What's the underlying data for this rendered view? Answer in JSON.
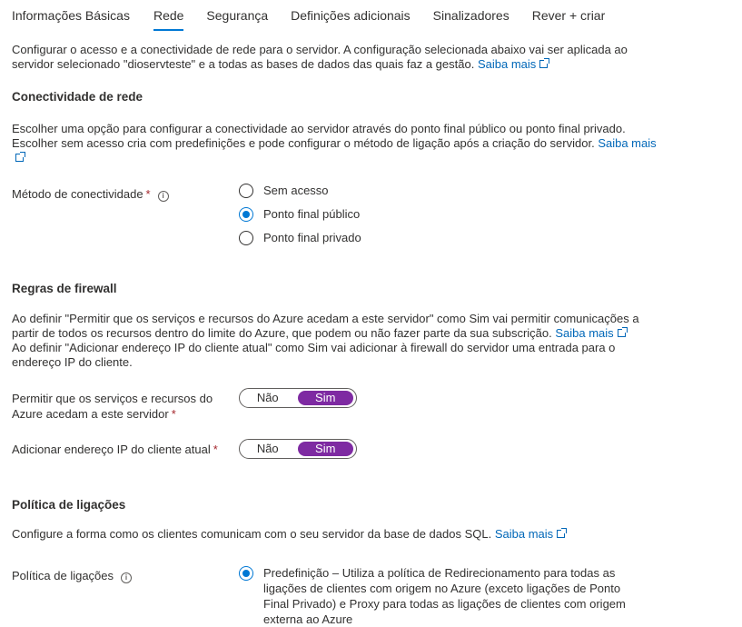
{
  "tabs": [
    {
      "label": "Informações Básicas",
      "active": false
    },
    {
      "label": "Rede",
      "active": true
    },
    {
      "label": "Segurança",
      "active": false
    },
    {
      "label": "Definições adicionais",
      "active": false
    },
    {
      "label": "Sinalizadores",
      "active": false
    },
    {
      "label": "Rever + criar",
      "active": false
    }
  ],
  "intro": {
    "text": "Configurar o acesso e a conectividade de rede para o servidor. A configuração selecionada abaixo vai ser aplicada ao servidor selecionado \"dioservteste\" e a todas as bases de dados das quais faz a gestão.",
    "link": "Saiba mais"
  },
  "connectivity": {
    "heading": "Conectividade de rede",
    "description": "Escolher uma opção para configurar a conectividade ao servidor através do ponto final público ou ponto final privado. Escolher sem acesso cria com predefinições e pode configurar o método de ligação após a criação do servidor.",
    "link": "Saiba mais",
    "method_label": "Método de conectividade",
    "required_mark": "*",
    "info_icon": "i",
    "options": [
      {
        "label": "Sem acesso",
        "checked": false
      },
      {
        "label": "Ponto final público",
        "checked": true
      },
      {
        "label": "Ponto final privado",
        "checked": false
      }
    ]
  },
  "firewall": {
    "heading": "Regras de firewall",
    "description_1": "Ao definir \"Permitir que os serviços e recursos do Azure acedam a este servidor\" como Sim vai permitir comunicações a partir de todos os recursos dentro do limite do Azure, que podem ou não fazer parte da sua subscrição.",
    "link": "Saiba mais",
    "description_2": "Ao definir \"Adicionar endereço IP do cliente atual\" como Sim vai adicionar à firewall do servidor uma entrada para o endereço IP do cliente.",
    "allow_azure_label": "Permitir que os serviços e recursos do Azure acedam a este servidor",
    "add_ip_label": "Adicionar endereço IP do cliente atual",
    "required_mark": "*",
    "toggle_no": "Não",
    "toggle_yes": "Sim",
    "allow_azure_value": "Sim",
    "add_ip_value": "Sim"
  },
  "connection_policy": {
    "heading": "Política de ligações",
    "description": "Configure a forma como os clientes comunicam com o seu servidor da base de dados SQL.",
    "link": "Saiba mais",
    "label": "Política de ligações",
    "info_icon": "i",
    "option_default": "Predefinição – Utiliza a política de Redirecionamento para todas as ligações de clientes com origem no Azure (exceto ligações de Ponto Final Privado) e Proxy para todas as ligações de clientes com origem externa ao Azure",
    "option_default_checked": true
  },
  "colors": {
    "accent": "#0078d4",
    "toggle_on": "#7e2aa2",
    "link": "#0067b8",
    "required": "#a4262c"
  }
}
